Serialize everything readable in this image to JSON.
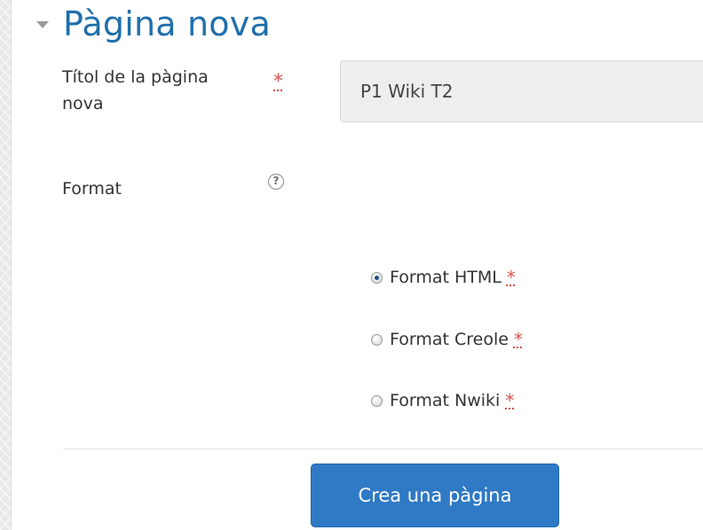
{
  "section": {
    "title": "Pàgina nova"
  },
  "form": {
    "title_label_line1": "Títol de la pàgina",
    "title_label_line2": "nova",
    "title_value": "P1 Wiki T2",
    "required_symbol": "*",
    "format_label": "Format",
    "help_symbol": "?",
    "format_options": [
      {
        "label": "Format HTML",
        "checked": true
      },
      {
        "label": "Format Creole",
        "checked": false
      },
      {
        "label": "Format Nwiki",
        "checked": false
      }
    ],
    "submit_label": "Crea una pàgina"
  },
  "colors": {
    "accent": "#1f6fab",
    "button": "#2f79c5",
    "required": "#d9534f"
  }
}
